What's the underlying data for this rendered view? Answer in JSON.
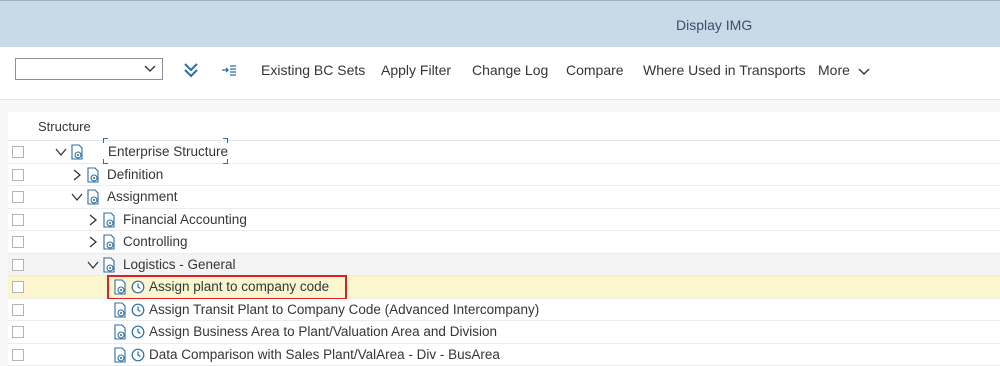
{
  "window": {
    "title": "Display IMG"
  },
  "toolbar": {
    "combo_value": "",
    "expand_all_icon": "double-chevron-down-icon",
    "collapse_icon": "indent-arrow-icon",
    "buttons": [
      "Existing BC Sets",
      "Apply Filter",
      "Change Log",
      "Compare",
      "Where Used in Transports"
    ],
    "more_label": "More"
  },
  "tree": {
    "header": "Structure",
    "rows": [
      {
        "label": "Enterprise Structure",
        "level": 0,
        "expanded": true
      },
      {
        "label": "Definition",
        "level": 1,
        "expanded": false
      },
      {
        "label": "Assignment",
        "level": 1,
        "expanded": true
      },
      {
        "label": "Financial Accounting",
        "level": 2,
        "expanded": false
      },
      {
        "label": "Controlling",
        "level": 2,
        "expanded": false
      },
      {
        "label": "Logistics - General",
        "level": 2,
        "expanded": true
      },
      {
        "label": "Assign plant to company code",
        "level": 3,
        "selected": true,
        "highlighted": true
      },
      {
        "label": "Assign Transit Plant to Company Code (Advanced Intercompany)",
        "level": 3
      },
      {
        "label": "Assign Business Area to Plant/Valuation Area and Division",
        "level": 3
      },
      {
        "label": "Data Comparison with Sales Plant/ValArea - Div - BusArea",
        "level": 3
      }
    ]
  },
  "colors": {
    "title_bar": "#cad9e8",
    "selected_row": "#fcf6cf",
    "highlight_box": "#e01e26",
    "icon_blue": "#2c6da3"
  }
}
